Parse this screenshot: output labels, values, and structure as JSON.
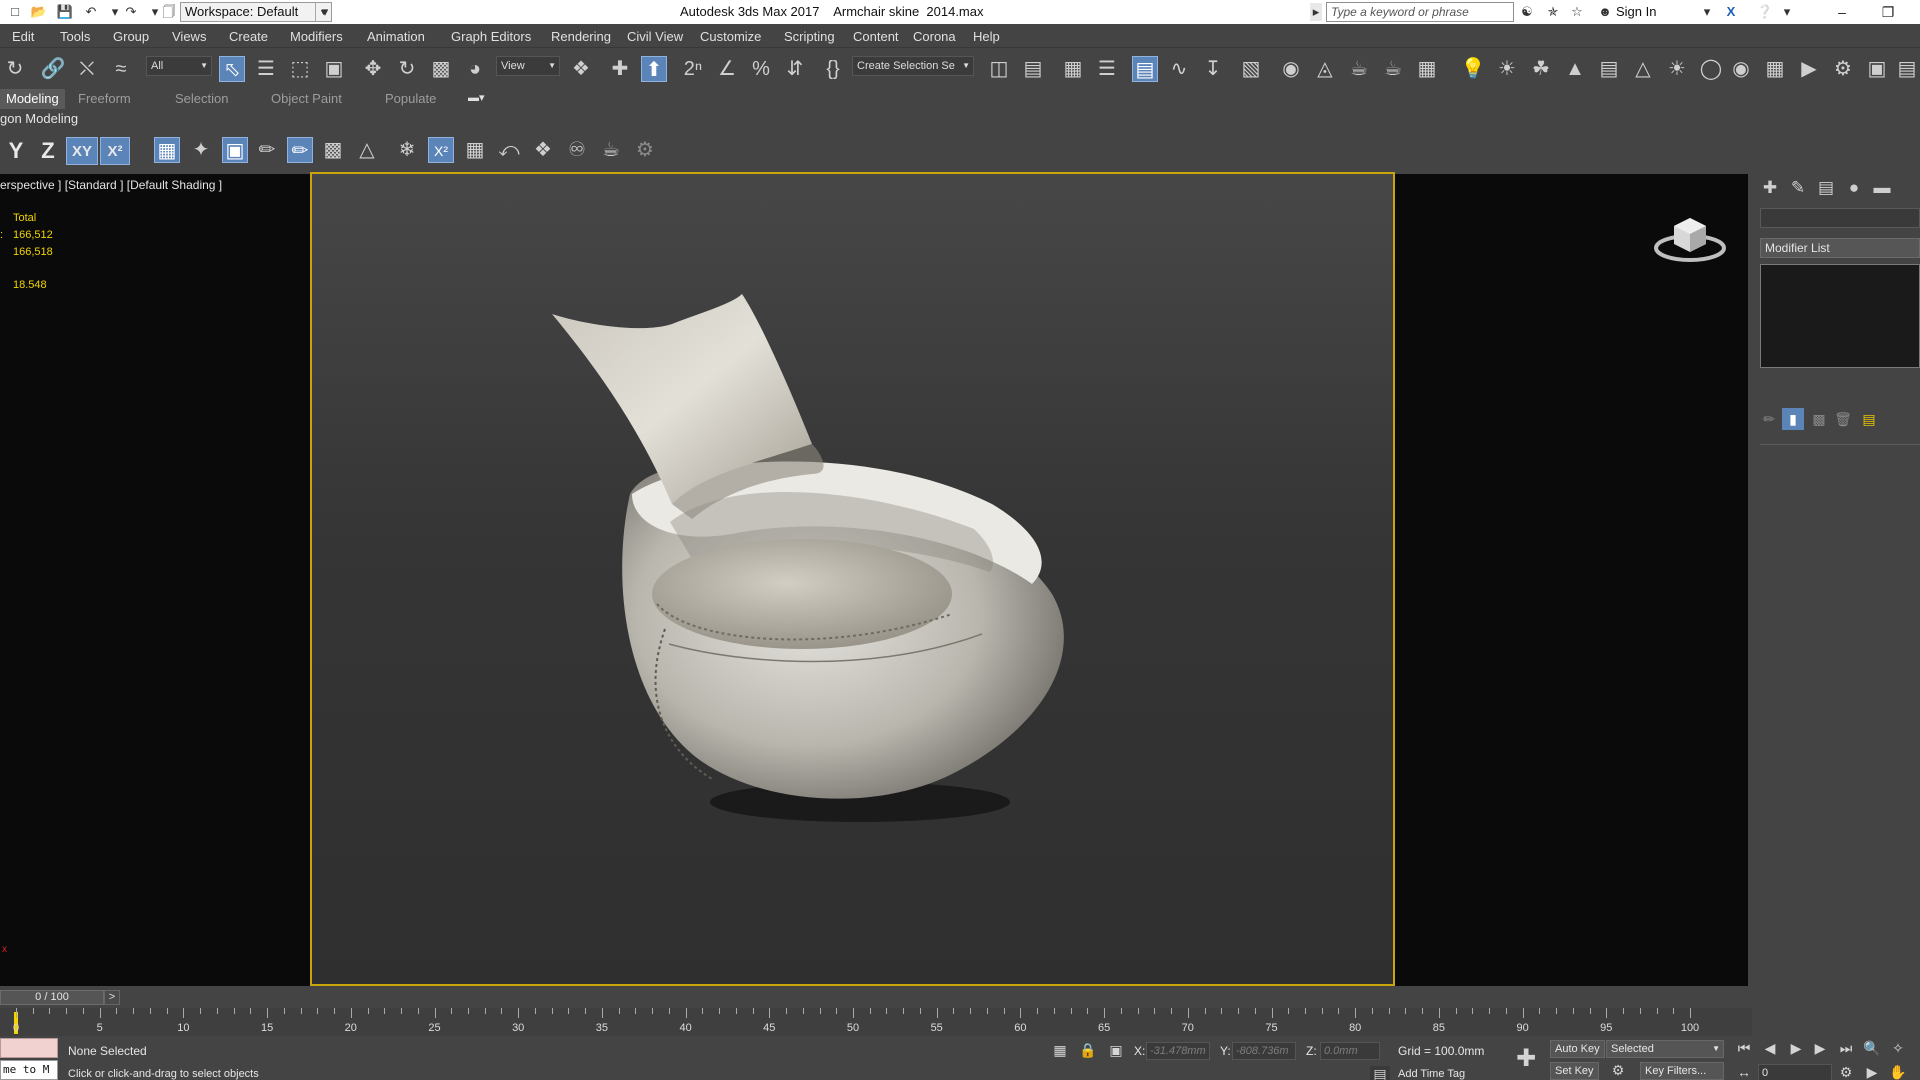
{
  "titlebar": {
    "workspace": "Workspace: Default",
    "app_title": "Autodesk 3ds Max 2017    Armchair skine  2014.max",
    "search_placeholder": "Type a keyword or phrase",
    "sign_in": "Sign In"
  },
  "menu": [
    "Edit",
    "Tools",
    "Group",
    "Views",
    "Create",
    "Modifiers",
    "Animation",
    "Graph Editors",
    "Rendering",
    "Civil View",
    "Customize",
    "Scripting",
    "Content",
    "Corona",
    "Help"
  ],
  "toolbar": {
    "selection_filter": "All",
    "ref_coord": "View",
    "named_selection": "Create Selection Se"
  },
  "ribbon": {
    "tabs": [
      "Modeling",
      "Freeform",
      "Selection",
      "Object Paint",
      "Populate"
    ],
    "active_tab": "Modeling",
    "panel_label": "gon Modeling"
  },
  "axis": {
    "y": "Y",
    "z": "Z",
    "xy": "XY",
    "xy2": "X²"
  },
  "viewport": {
    "label": "erspective ] [Standard ] [Default Shading ]",
    "stats_header": "Total",
    "stats": [
      "166,512",
      "166,518",
      "18.548"
    ]
  },
  "command_panel": {
    "modifier_list": "Modifier List"
  },
  "timeslider": {
    "position": "0 / 100",
    "next": ">"
  },
  "trackbar": {
    "labels": [
      "0",
      "5",
      "10",
      "15",
      "20",
      "25",
      "30",
      "35",
      "40",
      "45",
      "50",
      "55",
      "60",
      "65",
      "70",
      "75",
      "80",
      "85",
      "90",
      "95",
      "100"
    ]
  },
  "status": {
    "maxscript": "me to M",
    "selection": "None Selected",
    "prompt": "Click or click-and-drag to select objects",
    "x_label": "X:",
    "x_value": "-31.478mm",
    "y_label": "Y:",
    "y_value": "-808.736m",
    "z_label": "Z:",
    "z_value": "0.0mm",
    "grid": "Grid = 100.0mm",
    "add_time_tag": "Add Time Tag",
    "auto_key": "Auto Key",
    "set_key": "Set Key",
    "selected": "Selected",
    "key_filters": "Key Filters...",
    "frame": "0"
  },
  "colors": {
    "viewport_border": "#c9a40b",
    "stats_text": "#f1d400",
    "active_button": "#5b84b8"
  }
}
